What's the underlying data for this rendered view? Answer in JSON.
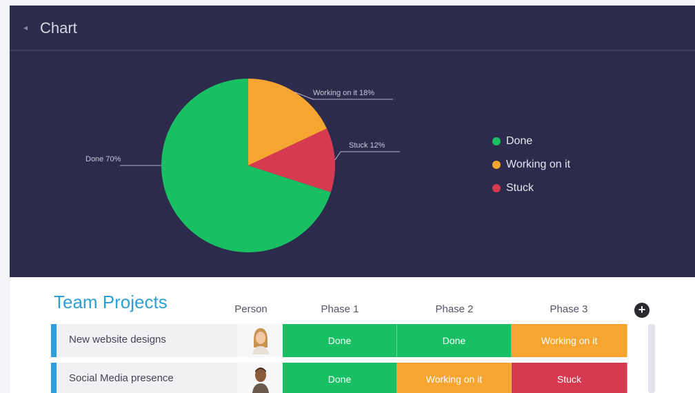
{
  "chart": {
    "title": "Chart",
    "collapse_icon": "chevron-left-icon",
    "labels": {
      "done": "Done 70%",
      "working": "Working on it 18%",
      "stuck": "Stuck 12%"
    },
    "legend": [
      {
        "label": "Done",
        "color": "#19c063"
      },
      {
        "label": "Working on it",
        "color": "#f6a531"
      },
      {
        "label": "Stuck",
        "color": "#d53a51"
      }
    ]
  },
  "chart_data": {
    "type": "pie",
    "categories": [
      "Done",
      "Working on it",
      "Stuck"
    ],
    "values": [
      70,
      18,
      12
    ],
    "colors": [
      "#19c063",
      "#f6a531",
      "#d53a51"
    ],
    "title": "Chart"
  },
  "table": {
    "title": "Team Projects",
    "columns": [
      "Person",
      "Phase 1",
      "Phase 2",
      "Phase 3"
    ],
    "add_icon": "plus-icon",
    "rows": [
      {
        "name": "New website designs",
        "avatar": "female-avatar",
        "phases": [
          {
            "label": "Done",
            "color": "#19c063"
          },
          {
            "label": "Done",
            "color": "#19c063"
          },
          {
            "label": "Working on it",
            "color": "#f6a531"
          }
        ]
      },
      {
        "name": "Social Media presence",
        "avatar": "male-avatar",
        "phases": [
          {
            "label": "Done",
            "color": "#19c063"
          },
          {
            "label": "Working on it",
            "color": "#f6a531"
          },
          {
            "label": "Stuck",
            "color": "#d53a51"
          }
        ]
      }
    ]
  }
}
